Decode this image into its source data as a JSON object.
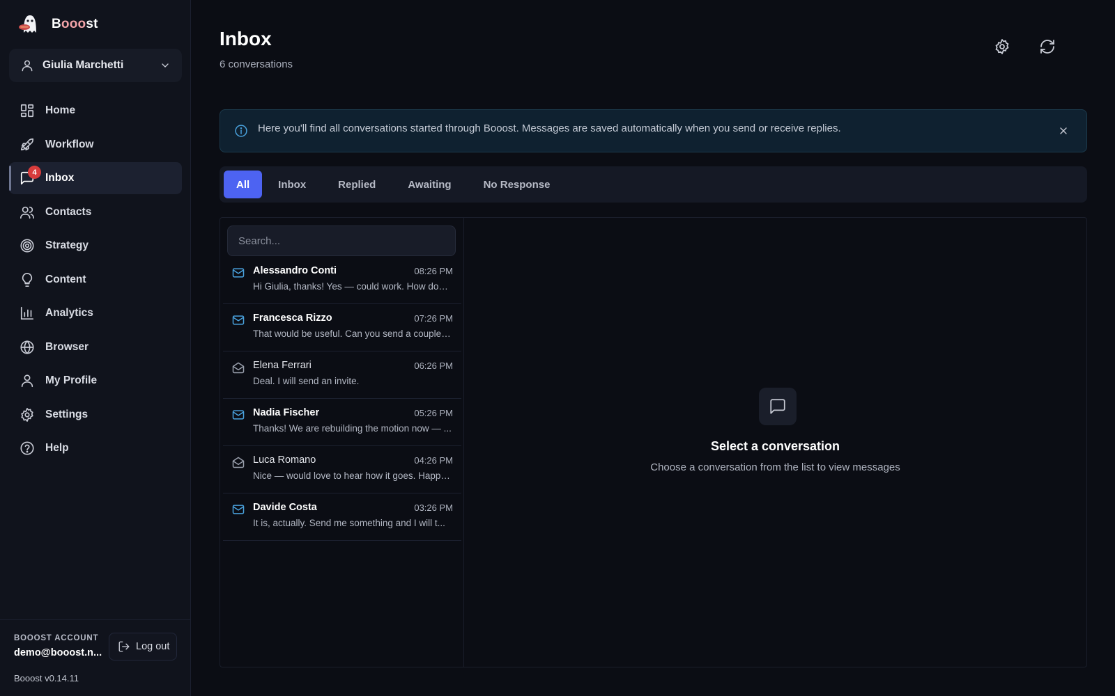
{
  "brand": {
    "name_start": "B",
    "name_accent": "ooo",
    "name_end": "st"
  },
  "account_select": {
    "name": "Giulia Marchetti"
  },
  "nav": {
    "items": [
      {
        "label": "Home",
        "icon": "grid-icon"
      },
      {
        "label": "Workflow",
        "icon": "rocket-icon"
      },
      {
        "label": "Inbox",
        "icon": "message-square-icon",
        "badge": "4",
        "active": true
      },
      {
        "label": "Contacts",
        "icon": "users-icon"
      },
      {
        "label": "Strategy",
        "icon": "target-icon"
      },
      {
        "label": "Content",
        "icon": "lightbulb-icon"
      },
      {
        "label": "Analytics",
        "icon": "bar-chart-icon"
      },
      {
        "label": "Browser",
        "icon": "globe-icon"
      },
      {
        "label": "My Profile",
        "icon": "user-icon"
      },
      {
        "label": "Settings",
        "icon": "gear-icon"
      },
      {
        "label": "Help",
        "icon": "help-circle-icon"
      }
    ]
  },
  "footer": {
    "account_label": "BOOOST ACCOUNT",
    "email": "demo@booost.n...",
    "logout_label": "Log out",
    "version": "Booost v0.14.11"
  },
  "header": {
    "title": "Inbox",
    "subtitle": "6 conversations"
  },
  "banner": {
    "text": "Here you'll find all conversations started through Booost. Messages are saved automatically when you send or receive replies."
  },
  "tabs": [
    {
      "label": "All",
      "active": true
    },
    {
      "label": "Inbox"
    },
    {
      "label": "Replied"
    },
    {
      "label": "Awaiting"
    },
    {
      "label": "No Response"
    }
  ],
  "search": {
    "placeholder": "Search..."
  },
  "conversations": [
    {
      "name": "Alessandro Conti",
      "time": "08:26 PM",
      "preview": "Hi Giulia, thanks! Yes — could work. How does...",
      "unread": true
    },
    {
      "name": "Francesca Rizzo",
      "time": "07:26 PM",
      "preview": "That would be useful. Can you send a couple ...",
      "unread": true
    },
    {
      "name": "Elena Ferrari",
      "time": "06:26 PM",
      "preview": "Deal. I will send an invite.",
      "unread": false
    },
    {
      "name": "Nadia Fischer",
      "time": "05:26 PM",
      "preview": "Thanks! We are rebuilding the motion now — ...",
      "unread": true
    },
    {
      "name": "Luca Romano",
      "time": "04:26 PM",
      "preview": "Nice — would love to hear how it goes. Happy...",
      "unread": false
    },
    {
      "name": "Davide Costa",
      "time": "03:26 PM",
      "preview": "It is, actually. Send me something and I will t...",
      "unread": true
    }
  ],
  "empty_state": {
    "title": "Select a conversation",
    "subtitle": "Choose a conversation from the list to view messages"
  },
  "colors": {
    "accent": "#4d63f2",
    "badge": "#d83c3c",
    "unread_mail": "#4aa3df",
    "read_mail": "#9aa0ad"
  }
}
